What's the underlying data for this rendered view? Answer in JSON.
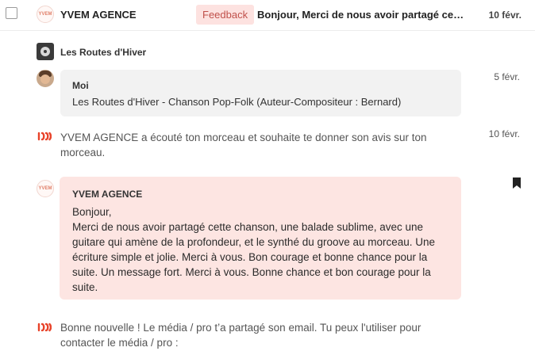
{
  "header": {
    "sender": "YVEM AGENCE",
    "logo_text": "YVEM",
    "badge": "Feedback",
    "subject": "Bonjour, Merci de nous avoir partagé cette chanson, une balade sublime",
    "date": "10 févr."
  },
  "project": {
    "name": "Les Routes d'Hiver",
    "icon": "vinyl-record-icon"
  },
  "message_me": {
    "author": "Moi",
    "text": "Les Routes d'Hiver - Chanson Pop-Folk (Auteur-Compositeur : Bernard)",
    "date": "5 févr."
  },
  "event_listen": {
    "icon": "brand-wave-icon",
    "text": "YVEM AGENCE a écouté ton morceau et souhaite te donner son avis sur ton morceau.",
    "date": "10 févr."
  },
  "message_agency": {
    "author": "YVEM AGENCE",
    "logo_text": "YVEM",
    "greeting": "Bonjour,",
    "body": "Merci de nous avoir partagé cette chanson, une balade sublime, avec une guitare qui amène de la profondeur, et le synthé du groove au morceau. Une écriture simple et jolie. Merci à vous. Bon courage et bonne chance pour la suite. Un message fort. Merci à vous. Bonne chance et bon courage pour la suite.",
    "bookmark_icon": "bookmark-icon"
  },
  "event_email": {
    "icon": "brand-wave-icon",
    "text": "Bonne nouvelle ! Le média / pro t’a partagé son email. Tu peux l'utiliser pour contacter le média / pro :"
  },
  "colors": {
    "badge_bg": "#fde2e0",
    "badge_text": "#c0504a",
    "agency_bubble": "#fde5e2",
    "brand": "#e8432a"
  }
}
